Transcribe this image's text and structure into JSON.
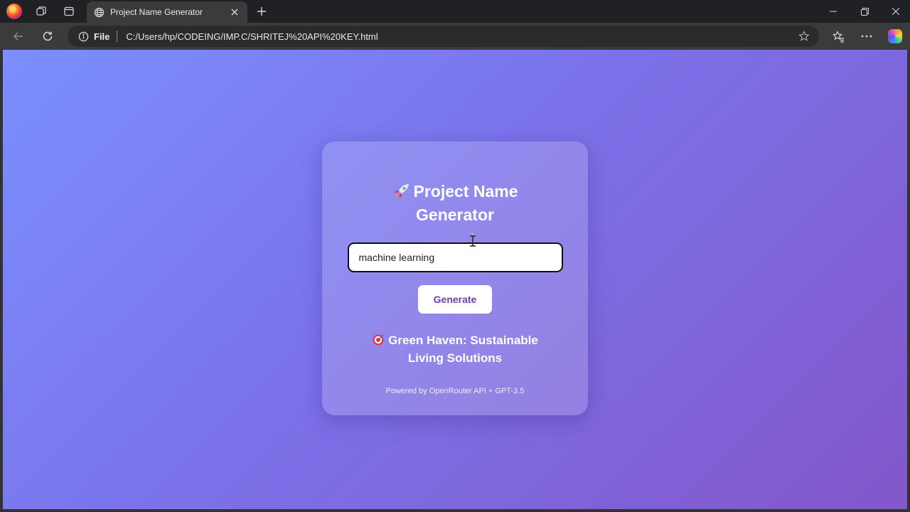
{
  "browser": {
    "tab_title": "Project Name Generator",
    "address_scheme": "File",
    "address_url": "C:/Users/hp/CODEING/IMP.C/SHRITEJ%20API%20KEY.html"
  },
  "app": {
    "heading": "Project Name Generator",
    "heading_icon": "rocket-icon",
    "input_value": "machine learning",
    "generate_label": "Generate",
    "result_icon": "target-icon",
    "result_text": "Green Haven: Sustainable Living Solutions",
    "footer_text": "Powered by OpenRouter API + GPT-3.5"
  },
  "colors": {
    "gradient_start": "#7b8ffd",
    "gradient_end": "#8357c9",
    "button_text": "#6b3fa8"
  }
}
